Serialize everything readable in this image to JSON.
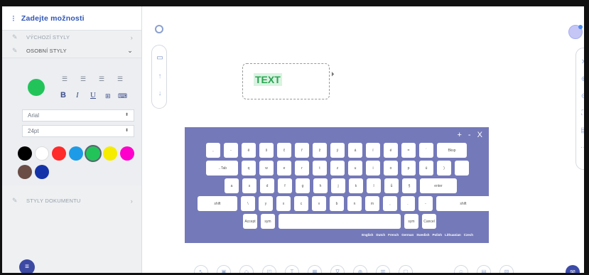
{
  "sidebar": {
    "title": "Zadejte možnosti",
    "sections": {
      "default_styles": "VÝCHOZÍ STYLY",
      "custom_styles": "OSOBNÍ STYLY",
      "document_styles": "STYLY DOKUMENTU"
    },
    "format": {
      "bold": "B",
      "italic": "I",
      "underline": "U",
      "font": "Arial",
      "size": "24pt"
    },
    "selected_color": "#22c45a",
    "palette": [
      "#000000",
      "#ffffff",
      "#ff2a2a",
      "#1e9be6",
      "#22c45a",
      "#f5ec00",
      "#ff00cc",
      "#6b4d46",
      "#1533a8"
    ]
  },
  "canvas": {
    "text_box": "TEXT"
  },
  "keyboard": {
    "controls": "+ - X",
    "rows": [
      [
        ",",
        "-",
        "ě",
        "š",
        "č",
        "ř",
        "ž",
        "ý",
        "á",
        "í",
        "é",
        "=",
        "´",
        "Bksp"
      ],
      [
        "→Tab",
        "q",
        "w",
        "e",
        "r",
        "t",
        "z",
        "u",
        "i",
        "o",
        "p",
        "ú",
        ")",
        ""
      ],
      [
        "a",
        "s",
        "d",
        "f",
        "g",
        "h",
        "j",
        "k",
        "l",
        "ů",
        "§",
        "enter"
      ],
      [
        "shift",
        "\\",
        "y",
        "x",
        "c",
        "v",
        "b",
        "n",
        "m",
        ",",
        ".",
        "-",
        "shift"
      ],
      [
        "Accept",
        "sym",
        "",
        "sym",
        "Cancel"
      ]
    ],
    "languages": [
      "English",
      "Dutch",
      "French",
      "German",
      "Swedish",
      "Polish",
      "Lithuanian",
      "Czech"
    ]
  }
}
